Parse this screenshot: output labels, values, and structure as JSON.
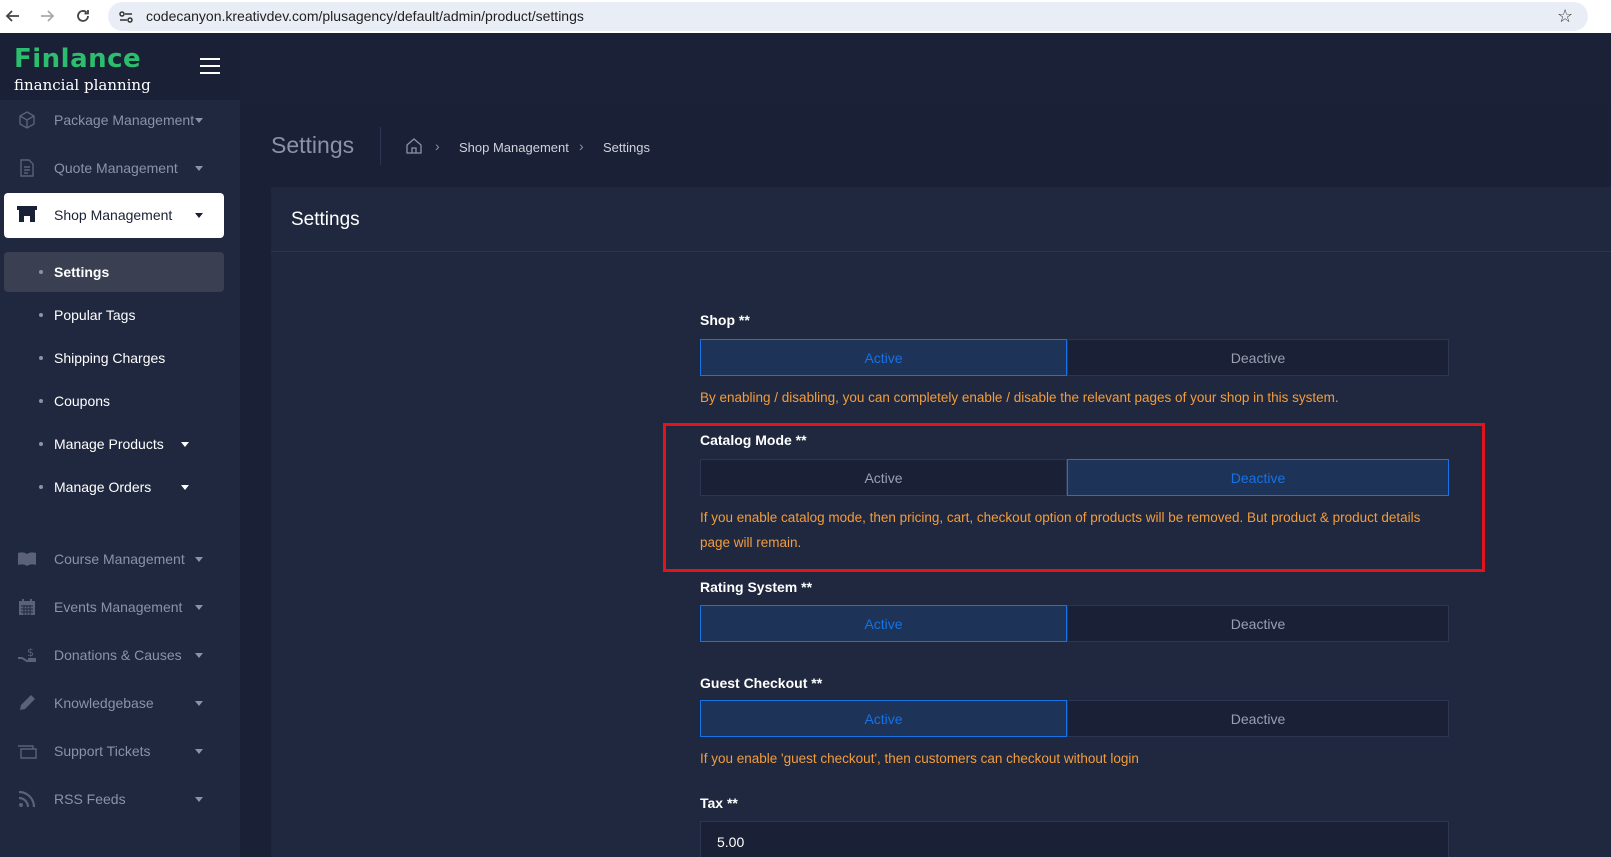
{
  "browser": {
    "url": "codecanyon.kreativdev.com/plusagency/default/admin/product/settings"
  },
  "sidebar": {
    "logo_main": "Finlance",
    "logo_sub": "financial planning",
    "items": [
      {
        "label": "Package Management"
      },
      {
        "label": "Quote Management"
      },
      {
        "label": "Shop Management"
      },
      {
        "label": "Course Management"
      },
      {
        "label": "Events Management"
      },
      {
        "label": "Donations & Causes"
      },
      {
        "label": "Knowledgebase"
      },
      {
        "label": "Support Tickets"
      },
      {
        "label": "RSS Feeds"
      }
    ],
    "submenu": [
      {
        "label": "Settings"
      },
      {
        "label": "Popular Tags"
      },
      {
        "label": "Shipping Charges"
      },
      {
        "label": "Coupons"
      },
      {
        "label": "Manage Products"
      },
      {
        "label": "Manage Orders"
      }
    ]
  },
  "header": {
    "title": "Settings",
    "breadcrumb": [
      "Shop Management",
      "Settings"
    ]
  },
  "card": {
    "title": "Settings"
  },
  "form": {
    "shop": {
      "label": "Shop **",
      "active": "Active",
      "deactive": "Deactive",
      "selected": "Active",
      "help": "By enabling / disabling, you can completely enable / disable the relevant pages of your shop in this system."
    },
    "catalog_mode": {
      "label": "Catalog Mode **",
      "active": "Active",
      "deactive": "Deactive",
      "selected": "Deactive",
      "help": "If you enable catalog mode, then pricing, cart, checkout option of products will be removed. But product & product details page will remain."
    },
    "rating_system": {
      "label": "Rating System **",
      "active": "Active",
      "deactive": "Deactive",
      "selected": "Active"
    },
    "guest_checkout": {
      "label": "Guest Checkout **",
      "active": "Active",
      "deactive": "Deactive",
      "selected": "Active",
      "help": "If you enable 'guest checkout', then customers can checkout without login"
    },
    "tax": {
      "label": "Tax **",
      "value": "5.00"
    }
  },
  "colors": {
    "accent": "#1572e8",
    "help_text": "#f39c3c",
    "highlight": "#e0141b",
    "brand_green": "#2dbd6e"
  }
}
